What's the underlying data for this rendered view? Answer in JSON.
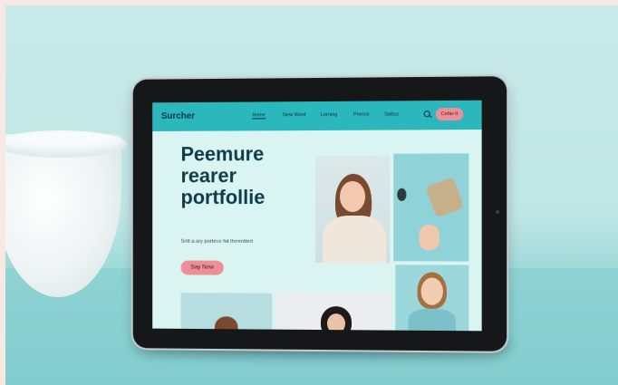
{
  "nav": {
    "brand": "Surcher",
    "links": [
      "Home",
      "New Ward",
      "Lerning",
      "Prence",
      "Sattus"
    ],
    "cta": "Cefar-II"
  },
  "hero": {
    "title_lines": [
      "Peemure",
      "rearer",
      "portfollie"
    ],
    "subtitle": "Sntt a.ary portece fat Ihrrenttert",
    "button": "Say Now"
  },
  "colors": {
    "nav_bar": "#2bb8bd",
    "screen_bg": "#d9f4f1",
    "accent_pink": "#ef8e98",
    "title_text": "#0f3c4a",
    "scene_bg": "#bfe6e5"
  }
}
